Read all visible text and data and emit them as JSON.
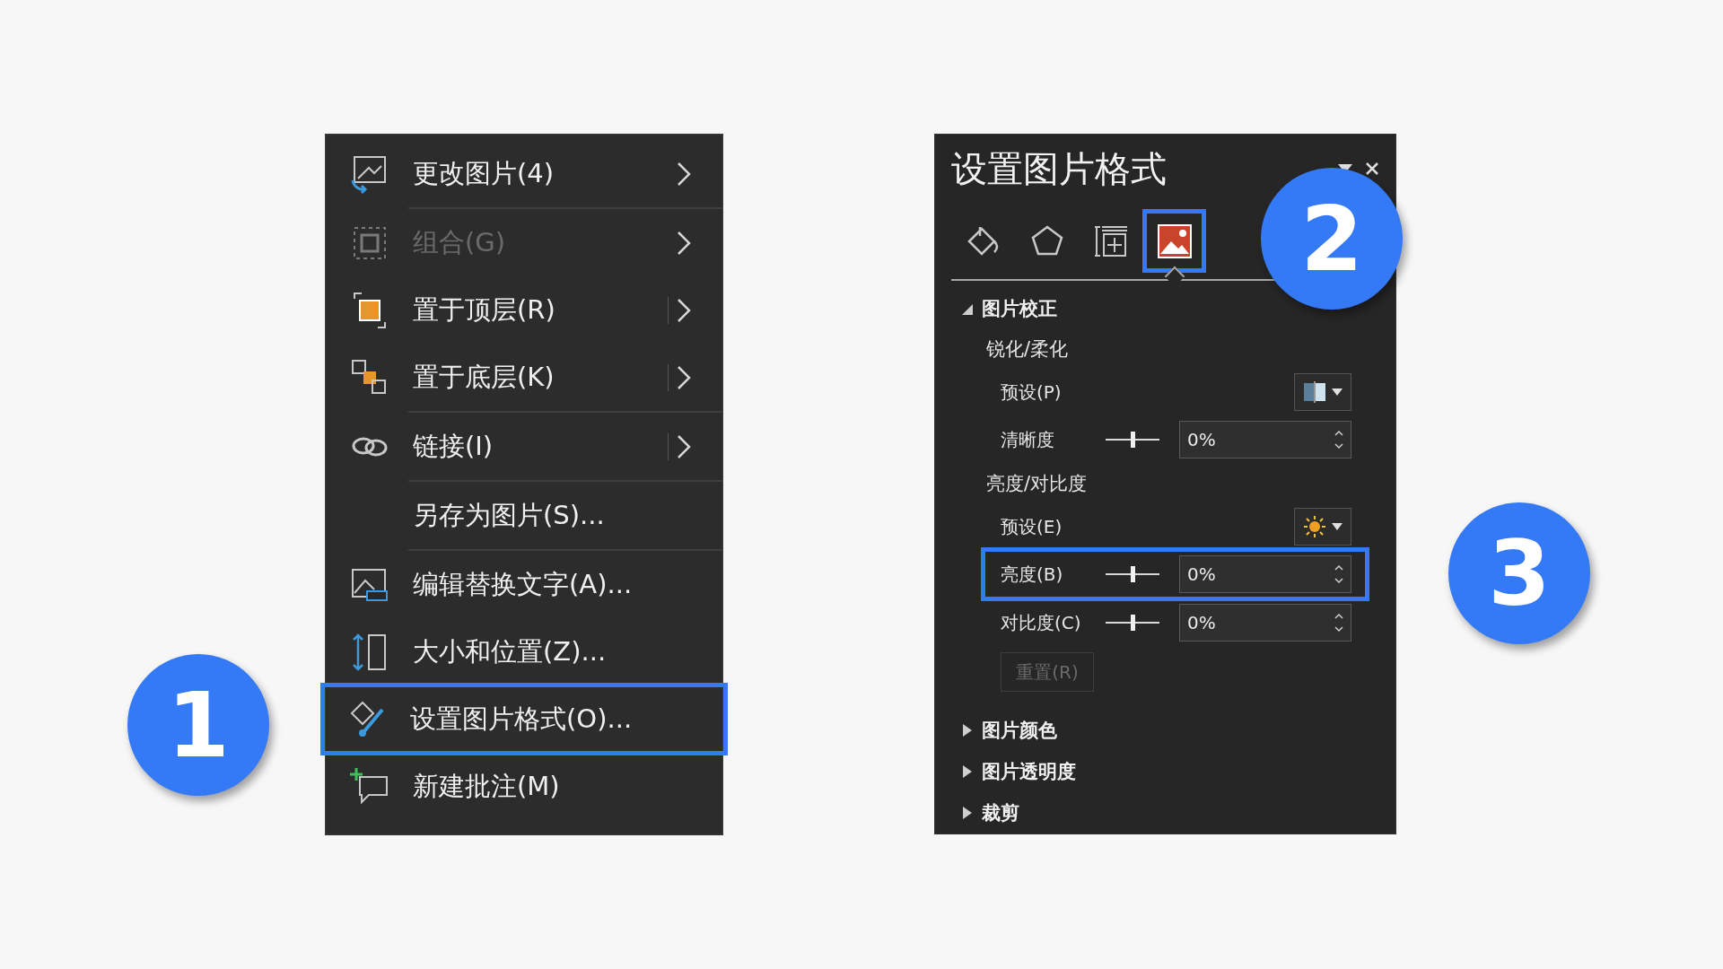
{
  "context_menu": {
    "items": [
      {
        "kind": "item",
        "label": "更改图片(4)",
        "disabled": false,
        "submenu": true,
        "split": false,
        "highlighted": false
      },
      {
        "kind": "separator"
      },
      {
        "kind": "item",
        "label": "组合(G)",
        "disabled": true,
        "submenu": true,
        "split": false,
        "highlighted": false
      },
      {
        "kind": "item",
        "label": "置于顶层(R)",
        "disabled": false,
        "submenu": true,
        "split": true,
        "highlighted": false
      },
      {
        "kind": "item",
        "label": "置于底层(K)",
        "disabled": false,
        "submenu": true,
        "split": true,
        "highlighted": false
      },
      {
        "kind": "separator"
      },
      {
        "kind": "item",
        "label": "链接(I)",
        "disabled": false,
        "submenu": true,
        "split": true,
        "highlighted": false
      },
      {
        "kind": "separator"
      },
      {
        "kind": "item",
        "label": "另存为图片(S)...",
        "disabled": false,
        "submenu": false,
        "split": false,
        "highlighted": false
      },
      {
        "kind": "separator"
      },
      {
        "kind": "item",
        "label": "编辑替换文字(A)...",
        "disabled": false,
        "submenu": false,
        "split": false,
        "highlighted": false
      },
      {
        "kind": "item",
        "label": "大小和位置(Z)...",
        "disabled": false,
        "submenu": false,
        "split": false,
        "highlighted": false
      },
      {
        "kind": "item",
        "label": "设置图片格式(O)...",
        "disabled": false,
        "submenu": false,
        "split": false,
        "highlighted": true
      },
      {
        "kind": "item",
        "label": "新建批注(M)",
        "disabled": false,
        "submenu": false,
        "split": false,
        "highlighted": false
      }
    ]
  },
  "format_pane": {
    "title": "设置图片格式",
    "tabs": [
      {
        "selected": false,
        "highlighted": false
      },
      {
        "selected": false,
        "highlighted": false
      },
      {
        "selected": false,
        "highlighted": false
      },
      {
        "selected": true,
        "highlighted": true
      }
    ],
    "sections": [
      {
        "label": "图片校正",
        "expanded": true,
        "rows": [
          {
            "kind": "subheading",
            "label": "锐化/柔化"
          },
          {
            "kind": "preset",
            "label": "预设(P)"
          },
          {
            "kind": "slider",
            "label": "清晰度",
            "level": 0.5,
            "value": "0%",
            "highlighted": false
          },
          {
            "kind": "subheading",
            "label": "亮度/对比度"
          },
          {
            "kind": "preset",
            "label": "预设(E)"
          },
          {
            "kind": "slider",
            "label": "亮度(B)",
            "level": 0.5,
            "value": "0%",
            "highlighted": true
          },
          {
            "kind": "slider",
            "label": "对比度(C)",
            "level": 0.5,
            "value": "0%",
            "highlighted": false
          },
          {
            "kind": "button",
            "label": "重置(R)",
            "disabled": true
          }
        ]
      },
      {
        "label": "图片颜色",
        "expanded": false
      },
      {
        "label": "图片透明度",
        "expanded": false
      },
      {
        "label": "裁剪",
        "expanded": false
      }
    ]
  },
  "step_badges": [
    {
      "number": "1"
    },
    {
      "number": "2"
    },
    {
      "number": "3"
    }
  ]
}
